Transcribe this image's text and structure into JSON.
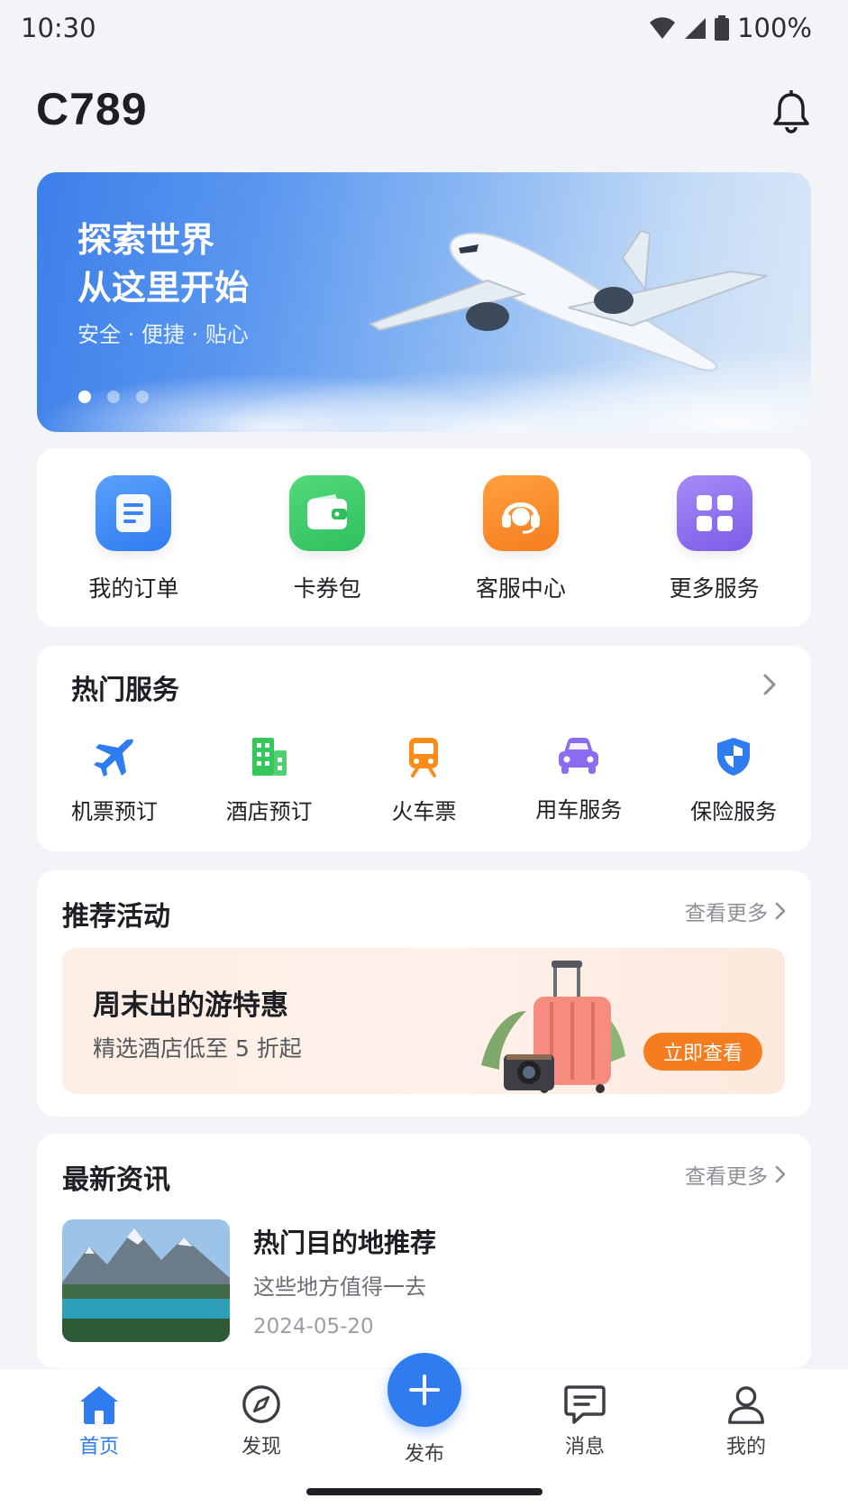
{
  "status_bar": {
    "time": "10:30",
    "battery": "100%"
  },
  "header": {
    "title": "C789",
    "bell_icon": "bell-icon"
  },
  "banner": {
    "line1": "探索世界",
    "line2": "从这里开始",
    "subtitle": "安全 · 便捷 · 贴心",
    "pages": 3,
    "active_page": 1
  },
  "quick_actions": [
    {
      "label": "我的订单",
      "icon": "order-list-icon",
      "color": "#3b82f6"
    },
    {
      "label": "卡券包",
      "icon": "wallet-icon",
      "color": "#34c759"
    },
    {
      "label": "客服中心",
      "icon": "headset-icon",
      "color": "#fb8c1a"
    },
    {
      "label": "更多服务",
      "icon": "grid-icon",
      "color": "#8b6cf0"
    }
  ],
  "hot_services": {
    "title": "热门服务",
    "items": [
      {
        "label": "机票预订",
        "icon": "airplane-icon",
        "color": "#2f7cf0"
      },
      {
        "label": "酒店预订",
        "icon": "hotel-building-icon",
        "color": "#34c759"
      },
      {
        "label": "火车票",
        "icon": "train-icon",
        "color": "#fb8c1a"
      },
      {
        "label": "用车服务",
        "icon": "car-icon",
        "color": "#8b6cf0"
      },
      {
        "label": "保险服务",
        "icon": "shield-icon",
        "color": "#2f7cf0"
      }
    ]
  },
  "recommend": {
    "title": "推荐活动",
    "more": "查看更多",
    "promo": {
      "title": "周末出的游特惠",
      "subtitle": "精选酒店低至 5 折起",
      "button": "立即查看"
    }
  },
  "news": {
    "title": "最新资讯",
    "more": "查看更多",
    "item": {
      "title": "热门目的地推荐",
      "subtitle": "这些地方值得一去",
      "date": "2024-05-20"
    }
  },
  "tabbar": {
    "tabs": [
      {
        "label": "首页",
        "icon": "home-icon",
        "active": true
      },
      {
        "label": "发现",
        "icon": "compass-icon",
        "active": false
      },
      {
        "label": "发布",
        "icon": "plus-icon",
        "active": false
      },
      {
        "label": "消息",
        "icon": "message-icon",
        "active": false
      },
      {
        "label": "我的",
        "icon": "user-icon",
        "active": false
      }
    ]
  }
}
